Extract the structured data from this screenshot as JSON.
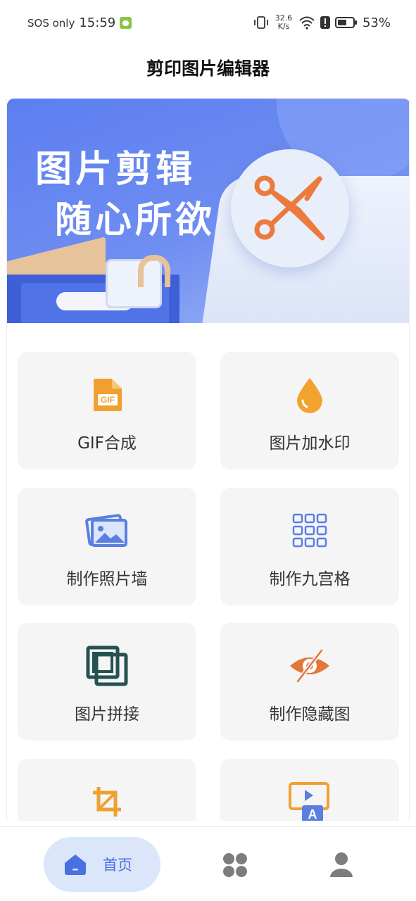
{
  "status_bar": {
    "sos": "SOS only",
    "time": "15:59",
    "speed_value": "32.6",
    "speed_unit": "K/s",
    "battery": "53%"
  },
  "header": {
    "title": "剪印图片编辑器"
  },
  "banner": {
    "line1": "图片剪辑",
    "line2": "随心所欲",
    "colors": {
      "background": "#5c7ef0",
      "scissors": "#ec7a3c"
    }
  },
  "features": [
    {
      "label": "GIF合成",
      "icon": "gif-file-icon"
    },
    {
      "label": "图片加水印",
      "icon": "water-drop-icon"
    },
    {
      "label": "制作照片墙",
      "icon": "photo-wall-icon"
    },
    {
      "label": "制作九宫格",
      "icon": "nine-grid-icon"
    },
    {
      "label": "图片拼接",
      "icon": "stitch-icon"
    },
    {
      "label": "制作隐藏图",
      "icon": "hidden-eye-icon"
    },
    {
      "label": "",
      "icon": "crop-icon"
    },
    {
      "label": "",
      "icon": "image-text-icon"
    }
  ],
  "bottom_nav": {
    "items": [
      {
        "label": "首页",
        "icon": "home-icon",
        "active": true
      },
      {
        "label": "",
        "icon": "apps-icon",
        "active": false
      },
      {
        "label": "",
        "icon": "profile-icon",
        "active": false
      }
    ],
    "active_color": "#4a6fe0"
  }
}
